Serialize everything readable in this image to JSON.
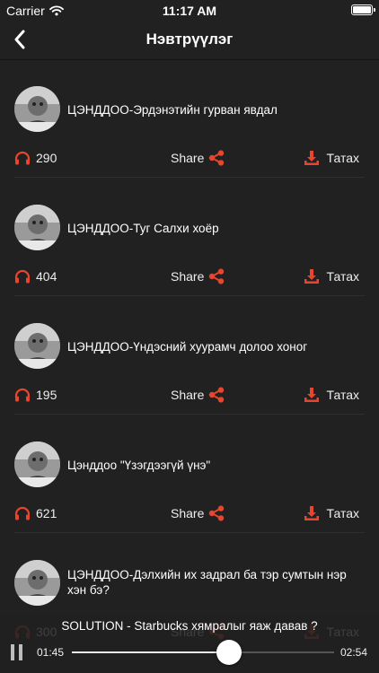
{
  "status_bar": {
    "carrier": "Carrier",
    "time": "11:17 AM"
  },
  "nav": {
    "title": "Нэвтрүүлэг",
    "back_icon": "chevron-left-icon"
  },
  "colors": {
    "accent": "#e8452e",
    "background": "#212121"
  },
  "episodes": [
    {
      "title": "ЦЭНДДОО-Эрдэнэтийн гурван явдал",
      "plays": "290",
      "share_label": "Share",
      "download_label": "Татах"
    },
    {
      "title": "ЦЭНДДОО-Туг Салхи хоёр",
      "plays": "404",
      "share_label": "Share",
      "download_label": "Татах"
    },
    {
      "title": "ЦЭНДДОО-Үндэсний хуурамч долоо хоног",
      "plays": "195",
      "share_label": "Share",
      "download_label": "Татах"
    },
    {
      "title": "Цэнддоо \"Үзэгдээгүй үнэ\"",
      "plays": "621",
      "share_label": "Share",
      "download_label": "Татах"
    },
    {
      "title": "ЦЭНДДОО-Дэлхийн их задрал ба тэр сумтын нэр хэн бэ?",
      "plays": "300",
      "share_label": "Share",
      "download_label": "Татах"
    }
  ],
  "player": {
    "title": "SOLUTION - Starbucks хямралыг яаж давав ?",
    "current_time": "01:45",
    "total_time": "02:54",
    "progress": 0.6
  }
}
